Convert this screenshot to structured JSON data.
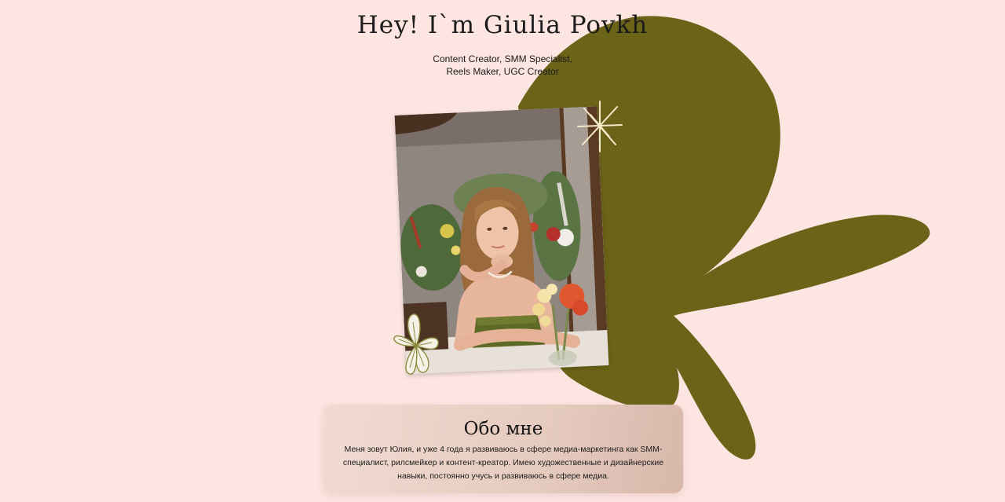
{
  "hero": {
    "title": "Hey! I`m Giulia Povkh",
    "subtitle_line1": "Content Creator, SMM Specialist,",
    "subtitle_line2": "Reels Maker, UGC Creator"
  },
  "about": {
    "title": "Обо мне",
    "text": "Меня зовут Юлия, и уже 4 года я развиваюсь в сфере медиа-маркетинга как SMM-специалист, рилсмейкер и контент-креатор. Имею художественные и дизайнерские навыки, постоянно учусь и развиваюсь в сфере медиа."
  },
  "colors": {
    "background": "#fde5e1",
    "blob": "#6b6418",
    "card_gradient_start": "#f1dbd2",
    "card_gradient_end": "#d7b8aa",
    "sparkle": "#f4e9c8"
  },
  "icons": {
    "sparkle": "sparkle-icon",
    "flower": "flower-doodle-icon",
    "blob": "organic-blob-shape"
  }
}
